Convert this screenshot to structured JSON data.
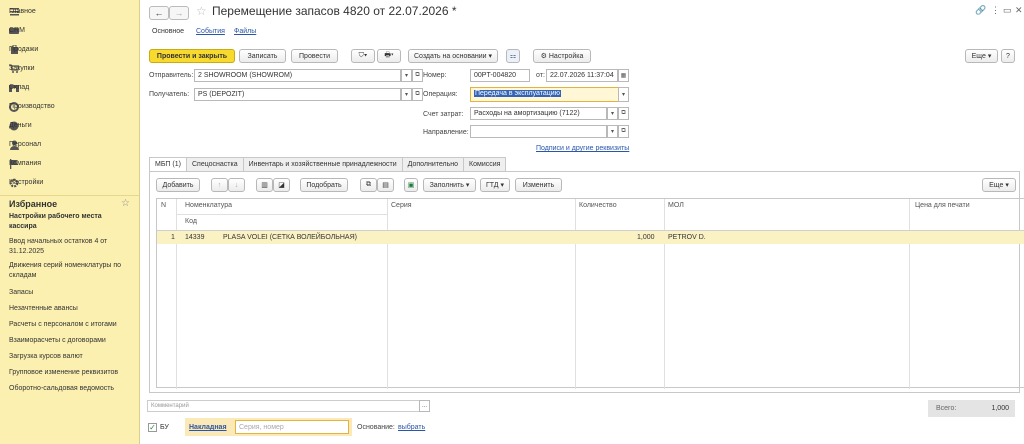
{
  "sidebar": {
    "nav": [
      {
        "label": "Главное",
        "icon": "menu-icon"
      },
      {
        "label": "CRM",
        "icon": "crm-icon"
      },
      {
        "label": "Продажи",
        "icon": "sales-icon"
      },
      {
        "label": "Закупки",
        "icon": "cart-icon"
      },
      {
        "label": "Склад",
        "icon": "warehouse-icon"
      },
      {
        "label": "Производство",
        "icon": "production-icon"
      },
      {
        "label": "Деньги",
        "icon": "money-icon"
      },
      {
        "label": "Персонал",
        "icon": "person-icon"
      },
      {
        "label": "Компания",
        "icon": "flag-icon"
      },
      {
        "label": "Настройки",
        "icon": "gear-icon"
      }
    ],
    "favorites_title": "Избранное",
    "favorites": [
      {
        "label": "Настройки рабочего места кассира",
        "bold": true
      },
      {
        "label": "Ввод начальных остатков 4 от 31.12.2025"
      },
      {
        "label": "Движения серий номенклатуры по складам"
      },
      {
        "label": "Запасы"
      },
      {
        "label": "Незачтенные авансы"
      },
      {
        "label": "Расчеты с персоналом с итогами"
      },
      {
        "label": "Взаиморасчеты с договорами"
      },
      {
        "label": "Загрузка курсов валют"
      },
      {
        "label": "Групповое изменение реквизитов"
      },
      {
        "label": "Оборотно-сальдовая ведомость"
      }
    ]
  },
  "header": {
    "title": "Перемещение запасов 4820 от 22.07.2026 *",
    "tabs": [
      "Основное",
      "События",
      "Файлы"
    ]
  },
  "toolbar": {
    "post_close": "Провести и закрыть",
    "save": "Записать",
    "post": "Провести",
    "create_based": "Создать на основании",
    "settings": "Настройка",
    "more": "Еще"
  },
  "form": {
    "sender_label": "Отправитель:",
    "sender_value": "2  SHOWROOM (SHOWROM)",
    "receiver_label": "Получатель:",
    "receiver_value": "PS (DEPOZIT)",
    "number_label": "Номер:",
    "number_value": "00PT-004820",
    "date_label": "от:",
    "date_value": "22.07.2026 11:37:04",
    "operation_label": "Операция:",
    "operation_value": "Передача в эксплуатацию",
    "cost_account_label": "Счет затрат:",
    "cost_account_value": "Расходы на амортизацию (7122)",
    "direction_label": "Направление:",
    "direction_value": "",
    "signatures_link": "Подписи и другие реквизиты"
  },
  "tabs2": [
    "МБП (1)",
    "Спецоснастка",
    "Инвентарь и хозяйственные принадлежности",
    "Дополнительно",
    "Комиссия"
  ],
  "table_toolbar": {
    "add": "Добавить",
    "pick": "Подобрать",
    "fill": "Заполнить",
    "gtd": "ГТД",
    "change": "Изменить",
    "more": "Еще"
  },
  "table": {
    "headers": {
      "n": "N",
      "nomenclature": "Номенклатура",
      "code": "Код",
      "series": "Серия",
      "quantity": "Количество",
      "mol": "МОЛ",
      "print_price": "Цена для печати"
    },
    "rows": [
      {
        "n": "1",
        "code": "14339",
        "name": "PLASA VOLEI (СЕТКА ВОЛЕЙБОЛЬНАЯ)",
        "series": "",
        "quantity": "1,000",
        "mol": "PETROV D.",
        "print_price": ""
      }
    ]
  },
  "footer": {
    "comment_placeholder": "Комментарий",
    "total_label": "Всего:",
    "total_value": "1,000",
    "bu_label": "БУ",
    "invoice_label": "Накладная",
    "series_placeholder": "Серия, номер",
    "basis_label": "Основание:",
    "basis_link": "выбрать"
  },
  "colors": {
    "sidebar_bg": "#fbf0b0",
    "primary_button": "#f8d92e",
    "link": "#2a56a8",
    "selected_row": "#fbf2c4"
  }
}
